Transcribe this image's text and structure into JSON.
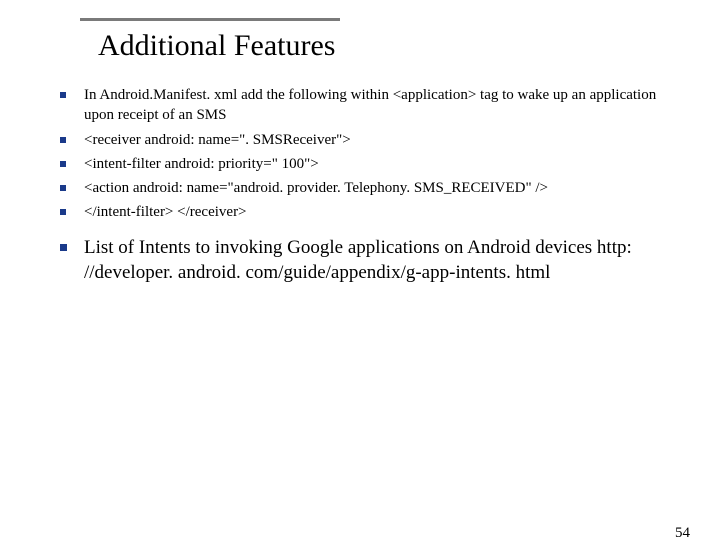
{
  "title": "Additional Features",
  "bullets_small": [
    "In Android.Manifest. xml add the following within <application> tag to wake up an application upon receipt of an SMS",
    "<receiver android: name=\". SMSReceiver\">",
    "<intent-filter android: priority=\" 100\">",
    "<action android: name=\"android. provider. Telephony. SMS_RECEIVED\" />",
    "</intent-filter> </receiver>"
  ],
  "bullets_big": [
    "List of Intents to invoking Google applications on Android devices http: //developer. android. com/guide/appendix/g-app-intents. html"
  ],
  "page_number": "54"
}
